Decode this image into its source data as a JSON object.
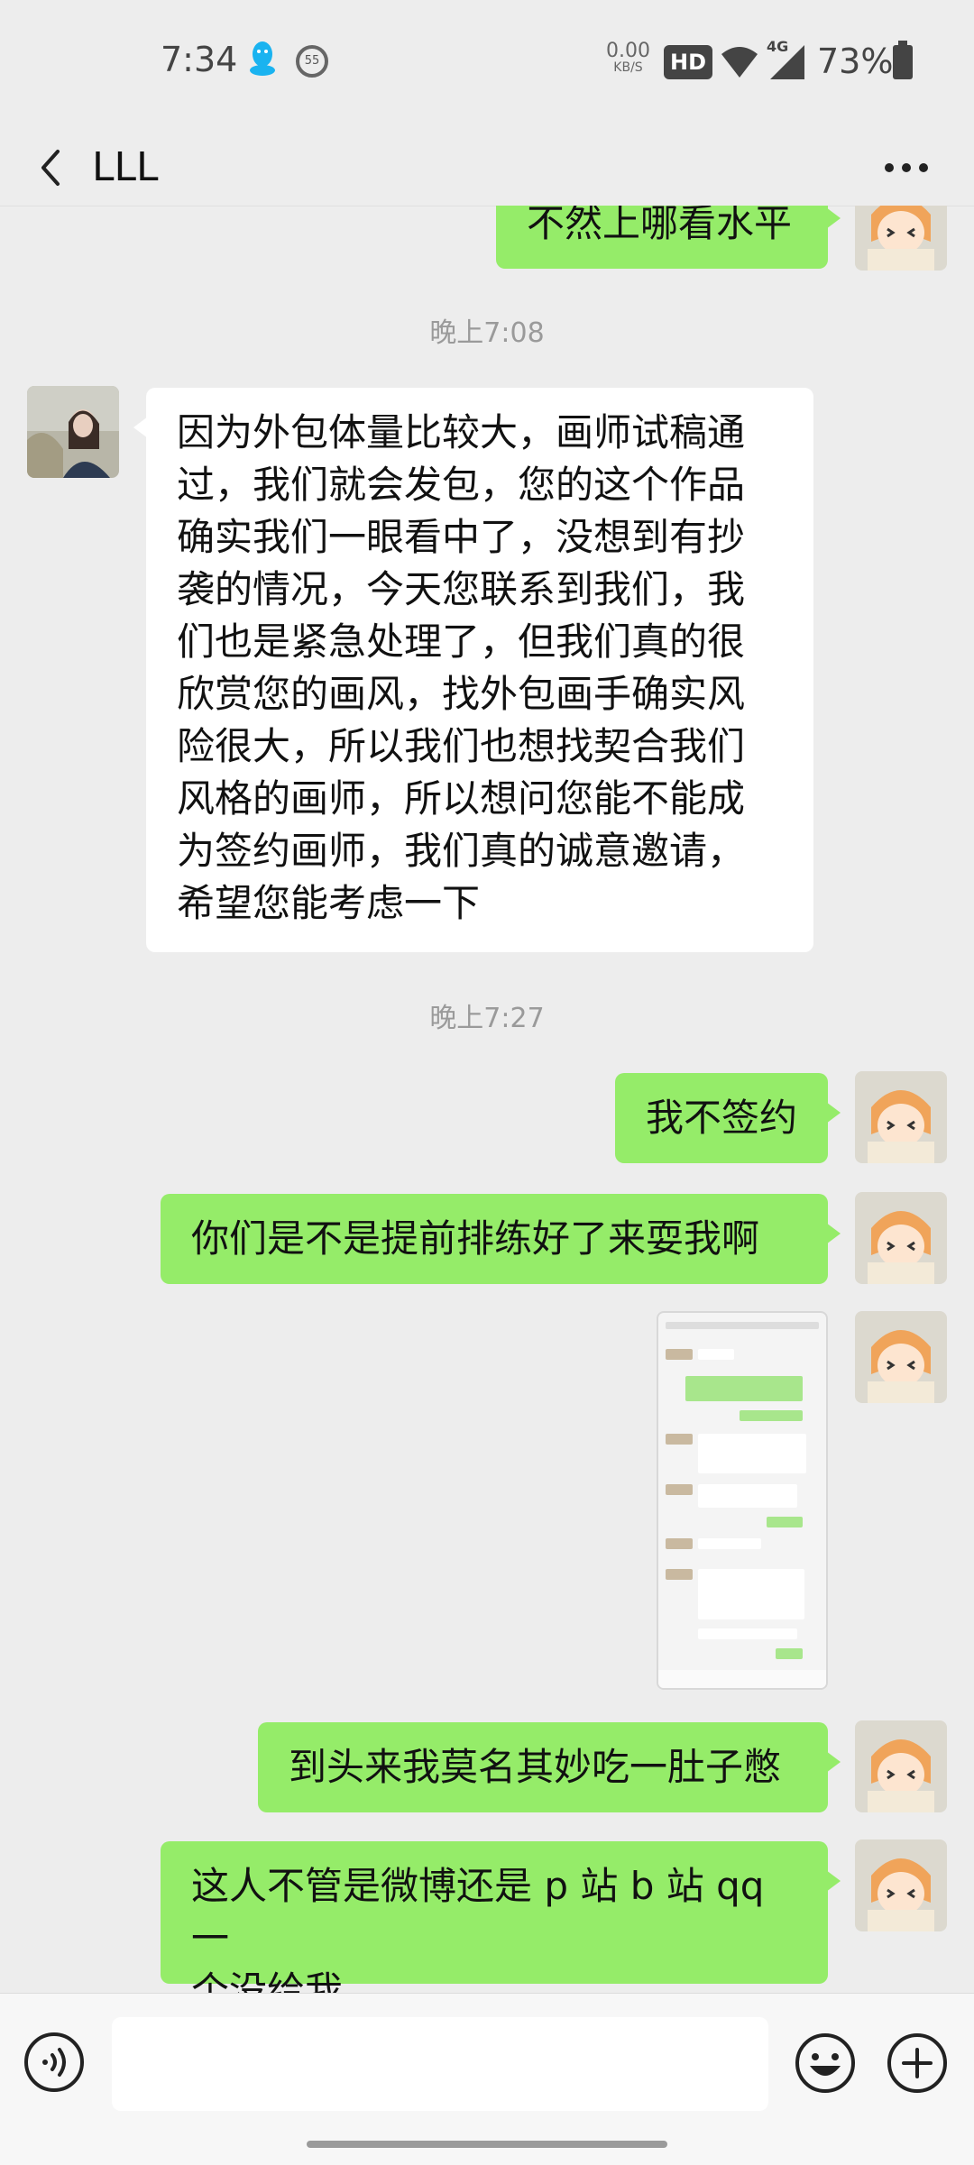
{
  "status_bar": {
    "time": "7:34",
    "ring_badge": "55",
    "net_speed_value": "0.00",
    "net_speed_unit": "KB/S",
    "hd": "HD",
    "signal_type": "4G",
    "battery": "73%"
  },
  "nav": {
    "title": "LLL",
    "back_icon": "chevron-left-icon",
    "more_icon": "more-icon"
  },
  "messages": [
    {
      "type": "text",
      "from": "me",
      "text": "不然上哪看水平"
    },
    {
      "type": "time",
      "text": "晚上7:08"
    },
    {
      "type": "text",
      "from": "other",
      "lines": [
        "因为外包体量比较大，画师试稿通",
        "过，我们就会发包，您的这个作品",
        "确实我们一眼看中了，没想到有抄",
        "袭的情况，今天您联系到我们，我",
        "们也是紧急处理了，但我们真的很",
        "欣赏您的画风，找外包画手确实风",
        "险很大，所以我们也想找契合我们",
        "风格的画师，所以想问您能不能成",
        "为签约画师，我们真的诚意邀请，",
        "希望您能考虑一下"
      ]
    },
    {
      "type": "time",
      "text": "晚上7:27"
    },
    {
      "type": "text",
      "from": "me",
      "text": "我不签约"
    },
    {
      "type": "text",
      "from": "me",
      "text": "你们是不是提前排练好了来耍我啊"
    },
    {
      "type": "image",
      "from": "me",
      "image_name": "screenshot-thumbnail"
    },
    {
      "type": "text",
      "from": "me",
      "text": "到头来我莫名其妙吃一肚子憋"
    },
    {
      "type": "text",
      "from": "me",
      "lines": [
        "这人不管是微博还是 p 站 b 站 qq 一",
        "个没给我"
      ]
    }
  ],
  "input_bar": {
    "voice_icon": "voice-icon",
    "emoji_icon": "emoji-icon",
    "plus_icon": "plus-icon"
  },
  "colors": {
    "me_bubble": "#95ec69",
    "other_bubble": "#ffffff",
    "background": "#ededed",
    "timestamp": "#9a9a9a"
  }
}
